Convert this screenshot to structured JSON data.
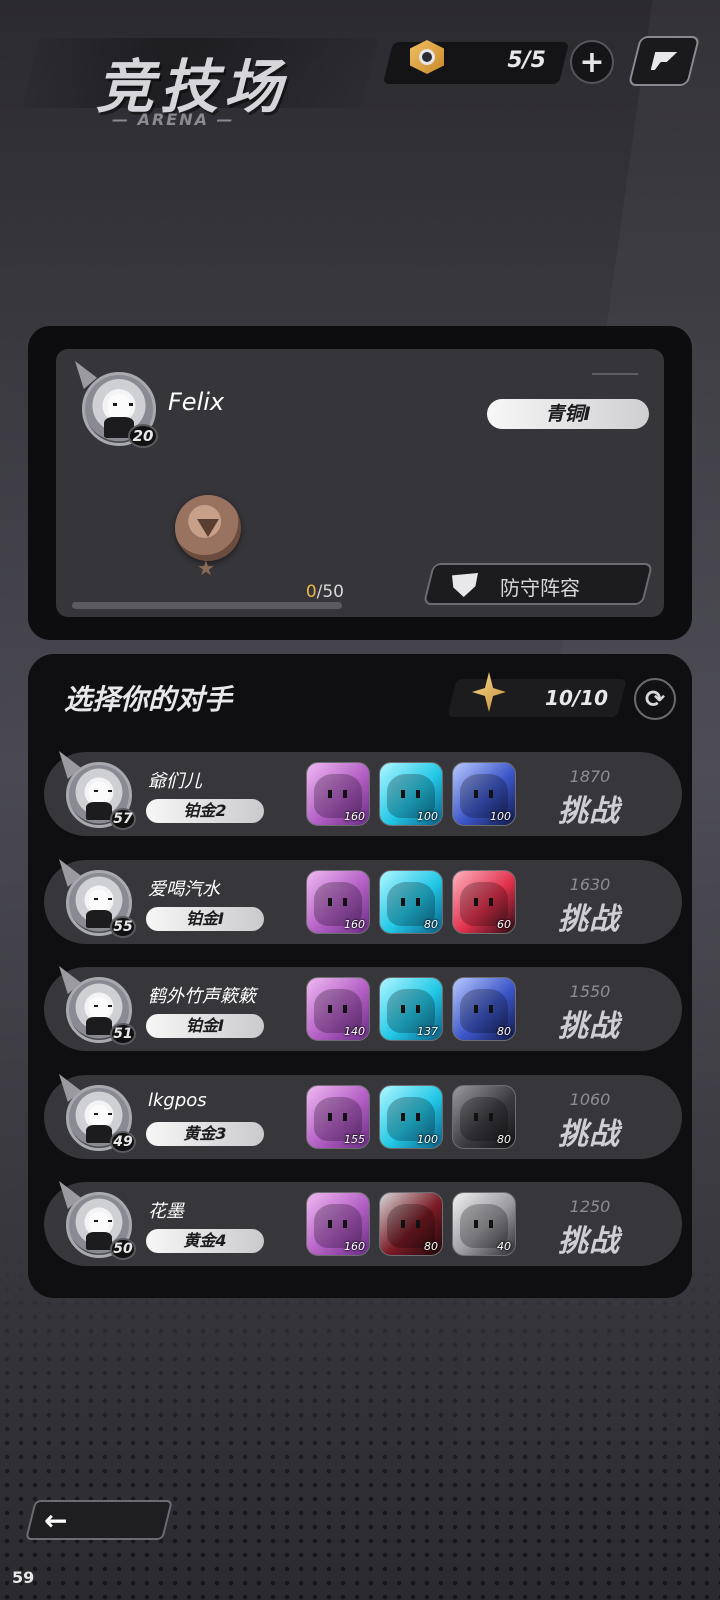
{
  "header": {
    "title": "竞技场",
    "subtitle": "— ARENA —",
    "tickets": "5/5"
  },
  "player": {
    "name": "Felix",
    "level": "20",
    "rank": "青铜I",
    "progress_current": "0",
    "progress_max": "/50",
    "progress_fraction": 0,
    "defense_label": "防守阵容"
  },
  "opponents": {
    "title": "选择你的对手",
    "refresh_count": "10/10",
    "challenge_label": "挑战",
    "list": [
      {
        "name": "爺们儿",
        "level": "57",
        "rank": "铂金2",
        "score": "1870",
        "heroes": [
          {
            "lvl": "160",
            "color": "purple"
          },
          {
            "lvl": "100",
            "color": "cyan"
          },
          {
            "lvl": "100",
            "color": "blue"
          }
        ]
      },
      {
        "name": "爱喝汽水",
        "level": "55",
        "rank": "铂金I",
        "score": "1630",
        "heroes": [
          {
            "lvl": "160",
            "color": "purple"
          },
          {
            "lvl": "80",
            "color": "cyan"
          },
          {
            "lvl": "60",
            "color": "red"
          }
        ]
      },
      {
        "name": "鹤外竹声簌簌",
        "level": "51",
        "rank": "铂金I",
        "score": "1550",
        "heroes": [
          {
            "lvl": "140",
            "color": "purple"
          },
          {
            "lvl": "137",
            "color": "cyan"
          },
          {
            "lvl": "80",
            "color": "blue"
          }
        ]
      },
      {
        "name": "lkgpos",
        "level": "49",
        "rank": "黄金3",
        "score": "1060",
        "heroes": [
          {
            "lvl": "155",
            "color": "purple"
          },
          {
            "lvl": "100",
            "color": "cyan"
          },
          {
            "lvl": "80",
            "color": "dark"
          }
        ]
      },
      {
        "name": "花墨",
        "level": "50",
        "rank": "黄金4",
        "score": "1250",
        "heroes": [
          {
            "lvl": "160",
            "color": "purple"
          },
          {
            "lvl": "80",
            "color": "crimson"
          },
          {
            "lvl": "40",
            "color": "gray"
          }
        ]
      }
    ]
  },
  "footer": {
    "back_arrow": "←",
    "fps": "59"
  }
}
